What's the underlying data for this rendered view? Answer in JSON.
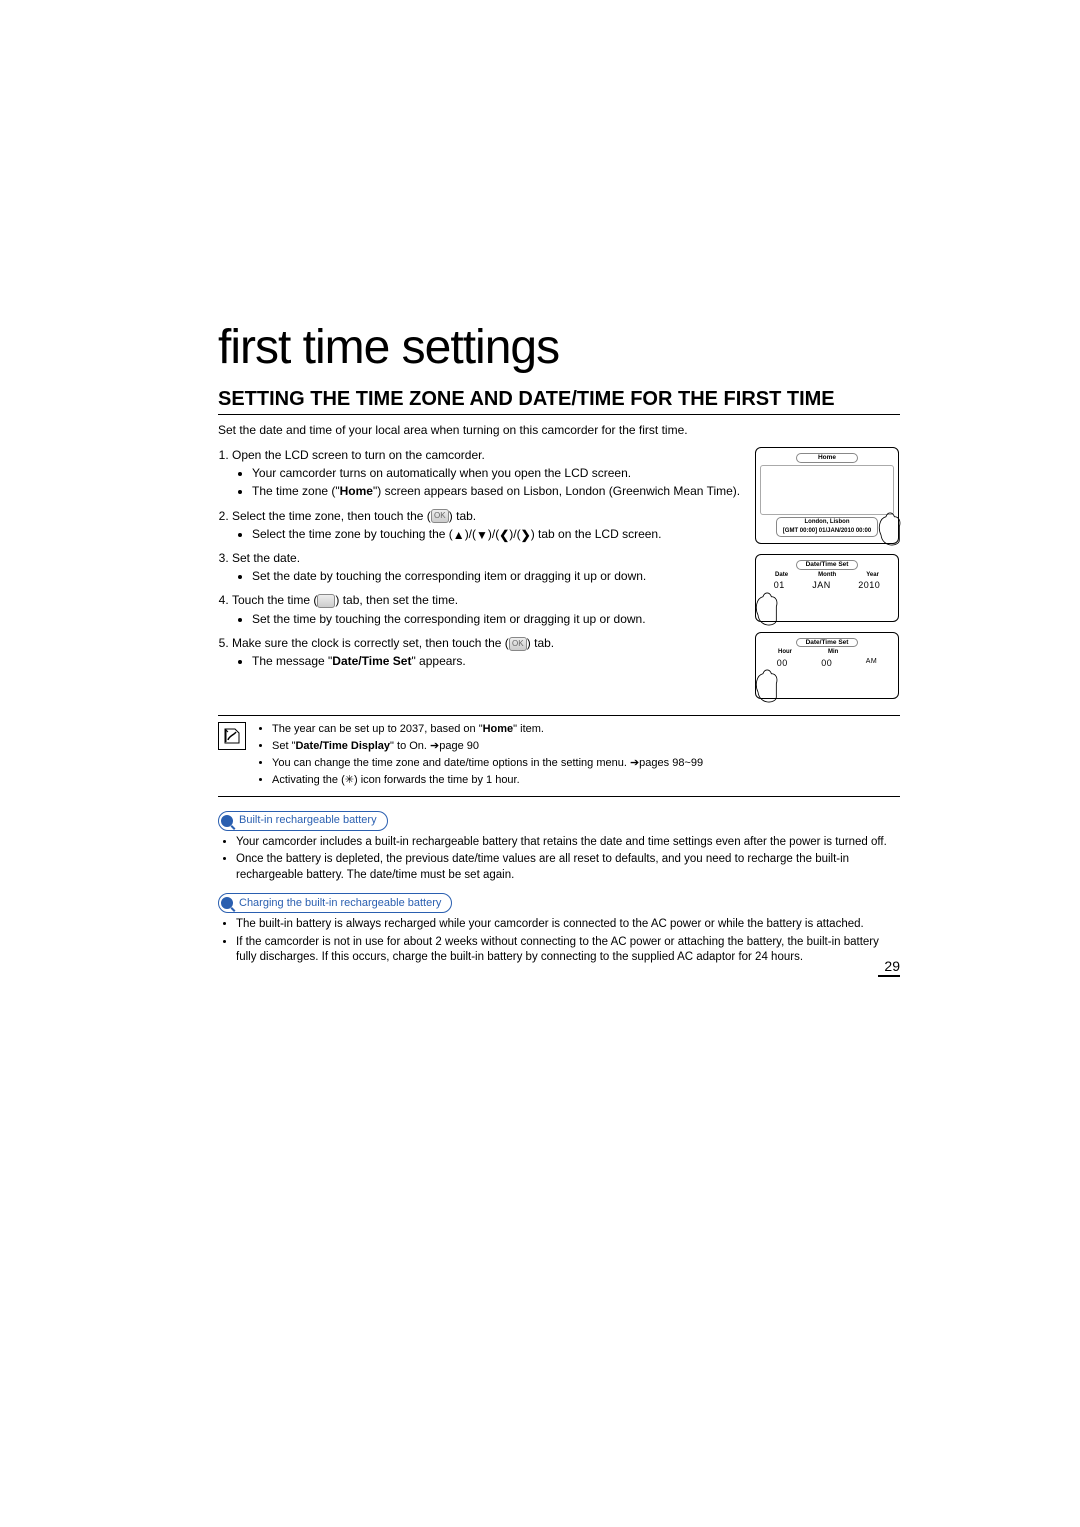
{
  "chapterTitle": "first time settings",
  "sectionTitle": "SETTING THE TIME ZONE AND DATE/TIME FOR THE FIRST TIME",
  "intro": "Set the date and time of your local area when turning on this camcorder for the first time.",
  "steps": {
    "s1": "Open the LCD screen to turn on the camcorder.",
    "s1a": "Your camcorder turns on automatically when you open the LCD screen.",
    "s1b_pre": "The time zone (\"",
    "s1b_bold": "Home",
    "s1b_post": "\") screen appears based on Lisbon, London (Greenwich Mean Time).",
    "s2_pre": "Select the time zone, then touch the (",
    "s2_post": ") tab.",
    "s2a_pre": "Select the time zone by touching the (",
    "s2a_mid1": ")/(",
    "s2a_mid2": ")/(",
    "s2a_mid3": ")/(",
    "s2a_post": ") tab on the LCD screen.",
    "s3": "Set the date.",
    "s3a": "Set the date by touching the corresponding item or dragging it up or down.",
    "s4_pre": "Touch the time (",
    "s4_post": ") tab, then set the time.",
    "s4a": "Set the time by touching the corresponding item or dragging it up or down.",
    "s5_pre": "Make sure the clock is correctly set, then touch the (",
    "s5_post": ") tab.",
    "s5a_pre": "The message \"",
    "s5a_bold": "Date/Time Set",
    "s5a_post": "\" appears."
  },
  "screens": {
    "home": {
      "title": "Home",
      "city": "London, Lisbon",
      "gmt": "[GMT 00:00] 01/JAN/2010 00:00"
    },
    "date": {
      "title": "Date/Time Set",
      "col1": "Date",
      "col2": "Month",
      "col3": "Year",
      "v1": "01",
      "v2": "JAN",
      "v3": "2010"
    },
    "time": {
      "title": "Date/Time Set",
      "col1": "Hour",
      "col2": "Min",
      "v1": "00",
      "v2": "00",
      "ampm": "AM"
    }
  },
  "notes": {
    "n1_pre": "The year can be set up to 2037, based on \"",
    "n1_bold": "Home",
    "n1_post": "\" item.",
    "n2_pre": "Set \"",
    "n2_bold": "Date/Time Display",
    "n2_post": "\" to On. ",
    "n2_ref": "page 90",
    "n3_pre": "You can change the time zone and date/time options in the setting menu. ",
    "n3_ref": "pages 98~99",
    "n4": "Activating the (✳) icon forwards the time by 1 hour."
  },
  "callout1": {
    "pill": "Built-in rechargeable battery",
    "c1": "Your camcorder includes a built-in rechargeable battery that retains the date and time settings even after the power is turned off.",
    "c2": "Once the battery is depleted, the previous date/time values are all reset to defaults, and you need to recharge the built-in rechargeable battery. The date/time must be set again."
  },
  "callout2": {
    "pill": "Charging the built-in rechargeable battery",
    "c1": "The built-in battery is always recharged while your camcorder is connected to the AC power or while the battery is attached.",
    "c2": "If the camcorder is not in use for about 2 weeks without connecting to the AC power or attaching the battery, the built-in battery fully discharges. If this occurs, charge the built-in battery by connecting to the supplied AC adaptor for 24 hours."
  },
  "pageNumber": "29",
  "refArrow": "➔"
}
